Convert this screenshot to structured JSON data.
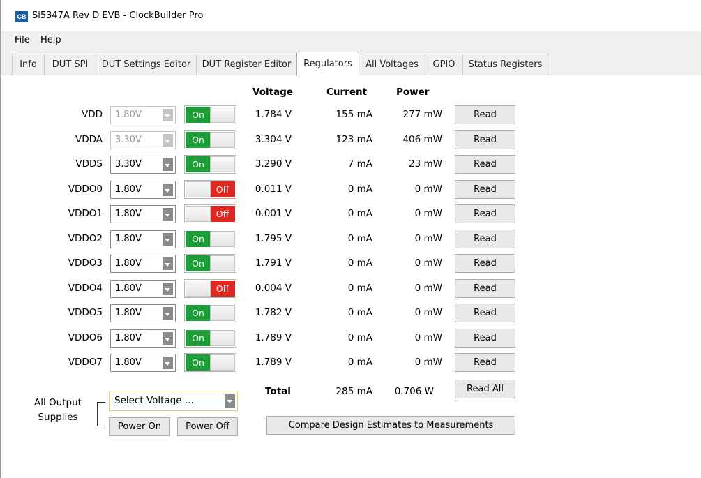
{
  "window": {
    "title": "Si5347A Rev D EVB - ClockBuilder Pro",
    "icon": "CB"
  },
  "menu": [
    "File",
    "Help"
  ],
  "tabs": [
    {
      "label": "Info",
      "active": false
    },
    {
      "label": "DUT SPI",
      "active": false
    },
    {
      "label": "DUT Settings Editor",
      "active": false
    },
    {
      "label": "DUT Register Editor",
      "active": false
    },
    {
      "label": "Regulators",
      "active": true
    },
    {
      "label": "All Voltages",
      "active": false
    },
    {
      "label": "GPIO",
      "active": false
    },
    {
      "label": "Status Registers",
      "active": false
    }
  ],
  "headers": {
    "voltage": "Voltage",
    "current": "Current",
    "power": "Power"
  },
  "rows": [
    {
      "name": "VDD",
      "setting": "1.80V",
      "enabled": false,
      "state": "On",
      "voltage": "1.784 V",
      "current": "155 mA",
      "power": "277 mW",
      "read": "Read"
    },
    {
      "name": "VDDA",
      "setting": "3.30V",
      "enabled": false,
      "state": "On",
      "voltage": "3.304 V",
      "current": "123 mA",
      "power": "406 mW",
      "read": "Read"
    },
    {
      "name": "VDDS",
      "setting": "3.30V",
      "enabled": true,
      "state": "On",
      "voltage": "3.290 V",
      "current": "7 mA",
      "power": "23 mW",
      "read": "Read"
    },
    {
      "name": "VDDO0",
      "setting": "1.80V",
      "enabled": true,
      "state": "Off",
      "voltage": "0.011 V",
      "current": "0 mA",
      "power": "0 mW",
      "read": "Read"
    },
    {
      "name": "VDDO1",
      "setting": "1.80V",
      "enabled": true,
      "state": "Off",
      "voltage": "0.001 V",
      "current": "0 mA",
      "power": "0 mW",
      "read": "Read"
    },
    {
      "name": "VDDO2",
      "setting": "1.80V",
      "enabled": true,
      "state": "On",
      "voltage": "1.795 V",
      "current": "0 mA",
      "power": "0 mW",
      "read": "Read"
    },
    {
      "name": "VDDO3",
      "setting": "1.80V",
      "enabled": true,
      "state": "On",
      "voltage": "1.791 V",
      "current": "0 mA",
      "power": "0 mW",
      "read": "Read"
    },
    {
      "name": "VDDO4",
      "setting": "1.80V",
      "enabled": true,
      "state": "Off",
      "voltage": "0.004 V",
      "current": "0 mA",
      "power": "0 mW",
      "read": "Read"
    },
    {
      "name": "VDDO5",
      "setting": "1.80V",
      "enabled": true,
      "state": "On",
      "voltage": "1.782 V",
      "current": "0 mA",
      "power": "0 mW",
      "read": "Read"
    },
    {
      "name": "VDDO6",
      "setting": "1.80V",
      "enabled": true,
      "state": "On",
      "voltage": "1.789 V",
      "current": "0 mA",
      "power": "0 mW",
      "read": "Read"
    },
    {
      "name": "VDDO7",
      "setting": "1.80V",
      "enabled": true,
      "state": "On",
      "voltage": "1.789 V",
      "current": "0 mA",
      "power": "0 mW",
      "read": "Read"
    }
  ],
  "totals": {
    "label": "Total",
    "current": "285 mA",
    "power": "0.706 W",
    "read_all": "Read All"
  },
  "all_outputs": {
    "label_line1": "All Output",
    "label_line2": "Supplies",
    "select_placeholder": "Select Voltage ...",
    "power_on": "Power On",
    "power_off": "Power Off"
  },
  "compare_button": "Compare Design Estimates to Measurements",
  "colors": {
    "on": "#1e9c3a",
    "off": "#e0261f",
    "tab_active_bg": "#ffffff"
  }
}
